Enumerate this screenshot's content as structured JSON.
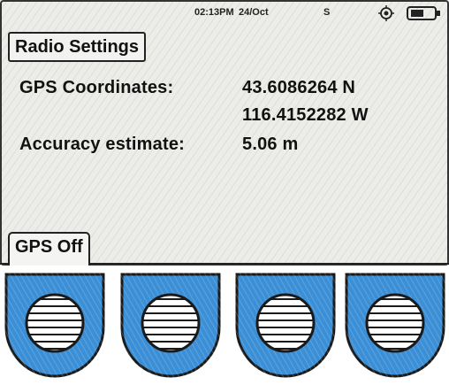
{
  "status_bar": {
    "time": "02:13PM",
    "date": "24/Oct",
    "signal": "S",
    "icons": [
      "gps-fix-icon",
      "battery-icon"
    ]
  },
  "title": "Radio Settings",
  "gps": {
    "coordinates_label": "GPS Coordinates:",
    "latitude": "43.6086264 N",
    "longitude": "116.4152282 W",
    "accuracy_label": "Accuracy estimate:",
    "accuracy_value": "5.06 m"
  },
  "tab": {
    "label": "GPS Off"
  },
  "softkeys": [
    {
      "icon": "speaker-grille-icon"
    },
    {
      "icon": "speaker-grille-icon"
    },
    {
      "icon": "speaker-grille-icon"
    },
    {
      "icon": "speaker-grille-icon"
    }
  ],
  "colors": {
    "softkey_fill": "#3b8fd6",
    "screen_bg": "#e9e9e6",
    "ink": "#1a1a1a"
  }
}
